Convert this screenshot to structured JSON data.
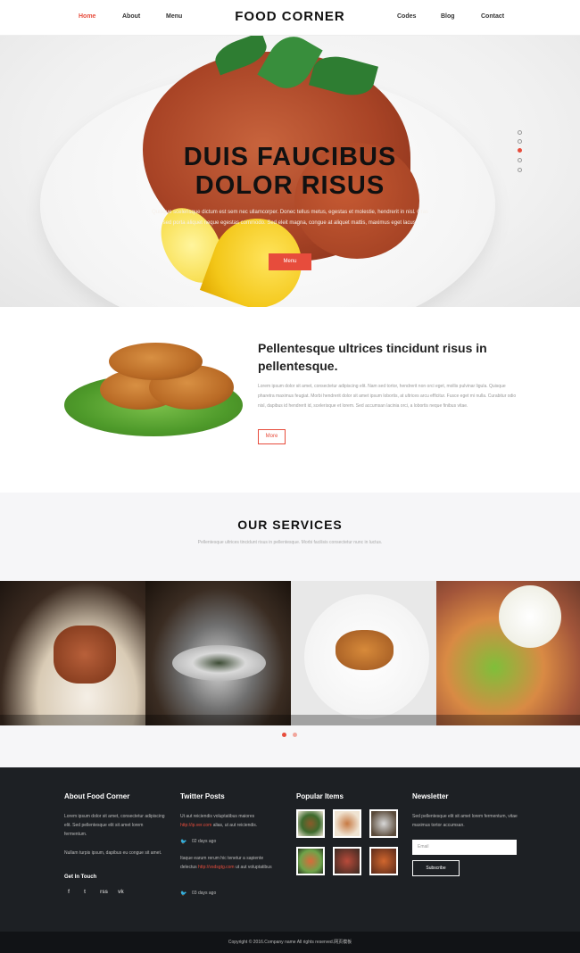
{
  "nav": {
    "left": [
      "Home",
      "About",
      "Menu"
    ],
    "right": [
      "Codes",
      "Blog",
      "Contact"
    ],
    "logo": "FOOD CORNER",
    "active": "Home",
    "accent_color": "#e74c3c"
  },
  "hero": {
    "title_line1": "DUIS FAUCIBUS",
    "title_line2": "DOLOR RISUS",
    "text": "Quisque scelerisque dictum est sem nec ullamcorper. Donec tellus metus, egestas et molestie, hendrerit in nisl. Cras sed porta aliquet neque egestas commodo. Sed eleit magna, congue at aliquet mattis, maximus eget lacus.",
    "button": "Menu",
    "slide_count": 5,
    "active_slide": 3
  },
  "about": {
    "title": "Pellentesque ultrices tincidunt risus in pellentesque.",
    "text": "Lorem ipsum dolor sit amet, consectetur adipiscing elit. Nam sed tortor, hendrerit non orci eget, mollis pulvinar ligula. Quisque pharetra maximus feugiat. Morbi hendrerit dolor sit amet ipsum lobortis, at ultrices arcu efficitur. Fusce eget mi nulla. Curabitur odio nisl, dapibus id hendrerit id, scelerisque et lorem. Sed accumsan lacinia orci, a lobortis neque finibus vitae.",
    "button": "More"
  },
  "services": {
    "title": "OUR SERVICES",
    "subtitle": "Pellentesque ultrices tincidunt risus in pellentesque. Morbi facilisis consectetur nunc in luctus.",
    "slider_pages": 2,
    "active_page": 1
  },
  "footer": {
    "about_title": "About Food Corner",
    "about_text1": "Lorem ipsum dolor sit amet, consectetur adipiscing elit. Sed pellentesque elit sit amet lorem fermentum.",
    "about_text2": "Nullam turpis ipsum, dapibus eu congue sit amet.",
    "get_in_touch": "Get In Touch",
    "social_icons": [
      "f",
      "t",
      "rss",
      "vk"
    ],
    "twitter_title": "Twitter Posts",
    "tweet1_pre": "Ut aut reiciendis voluptatibus maiores",
    "tweet1_link": "http://ip.ver.com",
    "tweet1_post": "alias, ut aut reiciendis.",
    "tweet1_time": "02 days ago",
    "tweet2_pre": "Itaque earum rerum hic tenetur a sapiente delectus",
    "tweet2_link": "http://vsdsgtg.com",
    "tweet2_post": "ut aut voluptatibus",
    "tweet2_time": "03 days ago",
    "popular_title": "Popular Items",
    "newsletter_title": "Newsletter",
    "newsletter_text": "Sed pellentesque elit sit amet lorem fermentum, vitae maximus tortor accumsan.",
    "email_placeholder": "Email",
    "subscribe": "Subscribe",
    "copyright": "Copyright © 2016.Company name All rights reserved.网页模板"
  }
}
